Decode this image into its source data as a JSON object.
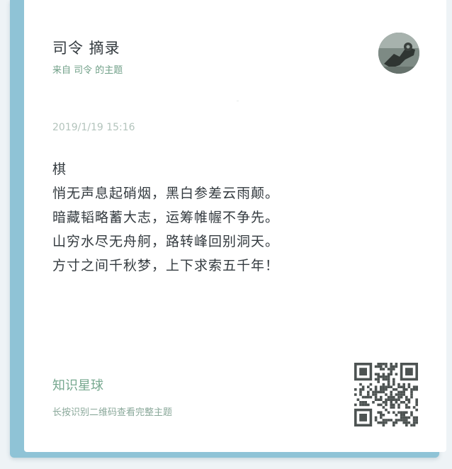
{
  "header": {
    "title": "司令 摘录",
    "subtitle": "来自 司令 的主题"
  },
  "post": {
    "date": "2019/1/19 15:16",
    "lines": [
      "棋",
      "悄无声息起硝烟，黑白参差云雨颠。",
      "暗藏韬略蓄大志，运筹帷幄不争先。",
      "山穷水尽无舟舸，路转峰回别洞天。",
      "方寸之间千秋梦，上下求索五千年！"
    ]
  },
  "footer": {
    "brand": "知识星球",
    "hint": "长按识别二维码查看完整主题"
  },
  "icons": {
    "avatar": "avatar-image",
    "qr": "qr-code-icon"
  },
  "colors": {
    "frame": "#8fc3d6",
    "accent_green": "#6f9f87",
    "text": "#333a3f"
  }
}
